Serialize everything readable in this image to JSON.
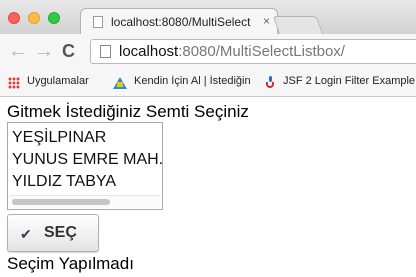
{
  "browser": {
    "tab_title": "localhost:8080/MultiSelect",
    "tab_close": "×",
    "url_host": "localhost",
    "url_path": ":8080/MultiSelectListbox/",
    "nav_back": "←",
    "nav_forward": "→",
    "nav_reload": "C",
    "bookmarks": [
      {
        "label": "Uygulamalar",
        "icon": "apps-icon"
      },
      {
        "label": "Kendin İçin Al | İstediğin",
        "icon": "drive-icon"
      },
      {
        "label": "JSF 2 Login Filter Example",
        "icon": "java-icon"
      }
    ]
  },
  "page": {
    "prompt": "Gitmek İstediğiniz Semti Seçiniz",
    "listbox_options": [
      "YEŞİLPINAR",
      "YUNUS EMRE MAH.",
      "YILDIZ TABYA"
    ],
    "button_label": "SEÇ",
    "button_icon": "✔",
    "status": "Seçim Yapılmadı"
  }
}
